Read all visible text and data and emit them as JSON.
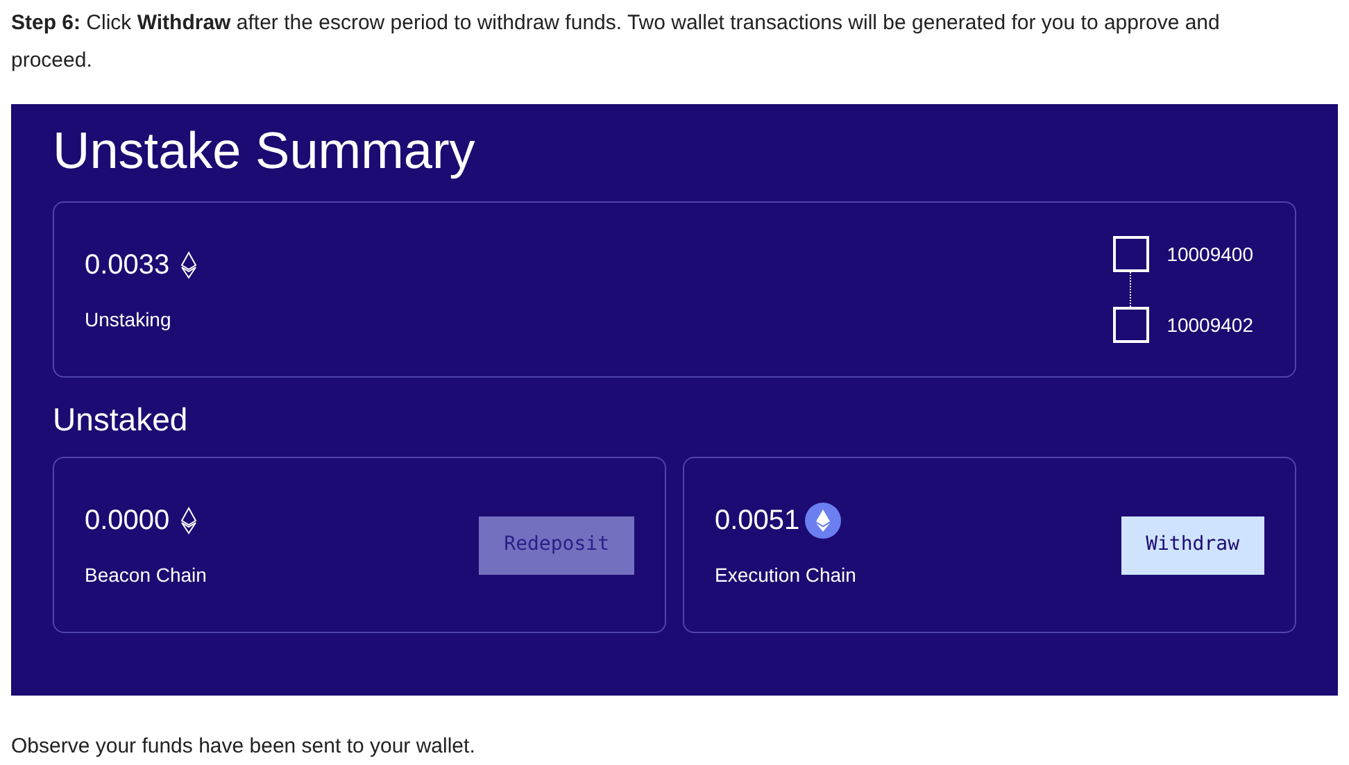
{
  "intro": "**Step 6:** Click **Withdraw** after the escrow period to withdraw funds. Two wallet transactions will be generated for you to approve and proceed.",
  "panel": {
    "title": "Unstake Summary",
    "unstaking": {
      "amount": "0.0033",
      "kind": "outline",
      "label": "Unstaking",
      "steps": [
        {
          "label": "10009400",
          "checked": false
        },
        {
          "label": "10009402",
          "checked": false
        }
      ]
    },
    "section_title": "Unstaked",
    "cards": [
      {
        "amount": "0.0000",
        "kind": "outline",
        "label": "Beacon Chain",
        "button": "Redeposit",
        "disabled": true
      },
      {
        "amount": "0.0051",
        "kind": "badge",
        "label": "Execution Chain",
        "button": "Withdraw",
        "disabled": false
      }
    ]
  },
  "footer": "Observe your funds have been sent to your wallet."
}
